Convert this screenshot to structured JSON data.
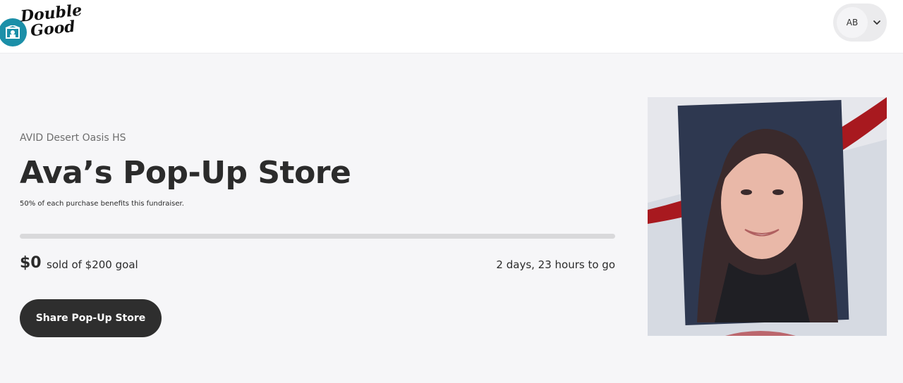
{
  "header": {
    "logo_line1": "Double",
    "logo_line2": "Good",
    "account_initials": "AB"
  },
  "store": {
    "org_name": "AVID Desert Oasis HS",
    "title": "Ava’s Pop-Up Store",
    "benefit_note": "50% of each purchase benefits this fundraiser.",
    "sold_amount": "$0",
    "sold_label": "sold of $200 goal",
    "progress_fraction": 0,
    "time_left": "2 days, 23 hours to go",
    "share_label": "Share Pop-Up Store"
  },
  "photo": {
    "icon": "person-portrait-image"
  },
  "colors": {
    "brand_teal": "#1b8fa8",
    "button_dark": "#2e2e2e",
    "progress_track": "#d9d9db"
  }
}
